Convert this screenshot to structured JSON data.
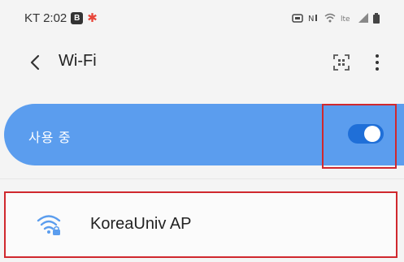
{
  "status_bar": {
    "carrier_time": "KT 2:02",
    "notif_badge": "B",
    "icons": [
      "alarm-icon",
      "signal-icon",
      "wifi-status-icon",
      "lte-icon",
      "signal-bars-icon",
      "battery-icon"
    ]
  },
  "app_bar": {
    "back_icon": "chevron-left-icon",
    "title": "Wi-Fi",
    "qr_icon": "qr-scan-icon",
    "more_icon": "more-vert-icon"
  },
  "master_toggle": {
    "label": "사용 중",
    "state": "on",
    "colors": {
      "bar": "#5b9dee",
      "track": "#1f6fd8",
      "highlight": "#d0282e"
    }
  },
  "networks": [
    {
      "name": "KoreaUniv AP",
      "icon": "wifi-lock-icon",
      "secured": true
    }
  ]
}
